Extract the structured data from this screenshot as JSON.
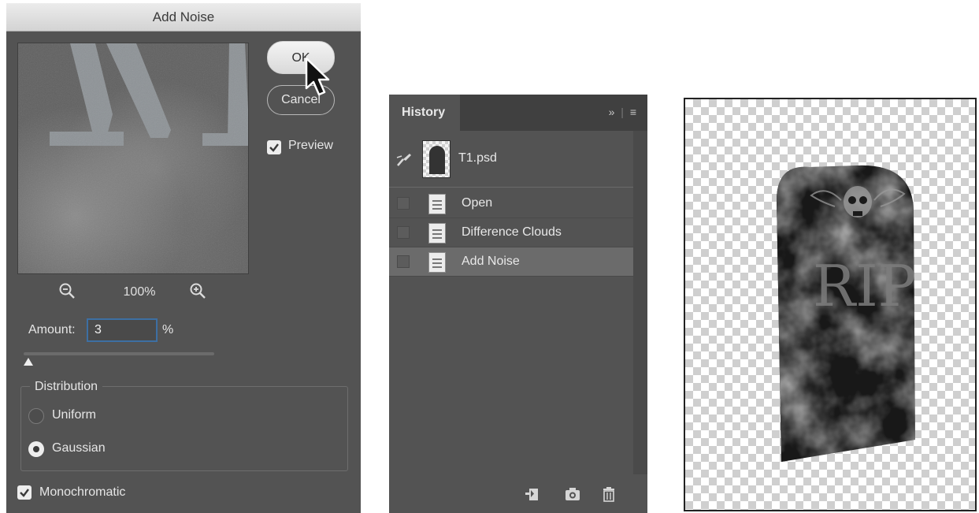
{
  "add_noise_dialog": {
    "title": "Add Noise",
    "ok_label": "OK",
    "cancel_label": "Cancel",
    "preview_label": "Preview",
    "preview_checked": true,
    "zoom_level": "100%",
    "amount_label": "Amount:",
    "amount_value": "3",
    "amount_unit": "%",
    "distribution": {
      "legend": "Distribution",
      "options": [
        "Uniform",
        "Gaussian"
      ],
      "selected": "Gaussian"
    },
    "monochromatic_label": "Monochromatic",
    "monochromatic_checked": true
  },
  "history_panel": {
    "tab_label": "History",
    "tab_menu_icons": [
      "expand-icon",
      "panel-menu-icon"
    ],
    "snapshot": {
      "name": "T1.psd"
    },
    "states": [
      {
        "name": "Open",
        "selected": false
      },
      {
        "name": "Difference Clouds",
        "selected": false
      },
      {
        "name": "Add Noise",
        "selected": true
      }
    ],
    "footer_icons": [
      "new-document-from-state-icon",
      "camera-icon",
      "trash-icon"
    ]
  },
  "canvas": {
    "tombstone_text": "RIP"
  }
}
